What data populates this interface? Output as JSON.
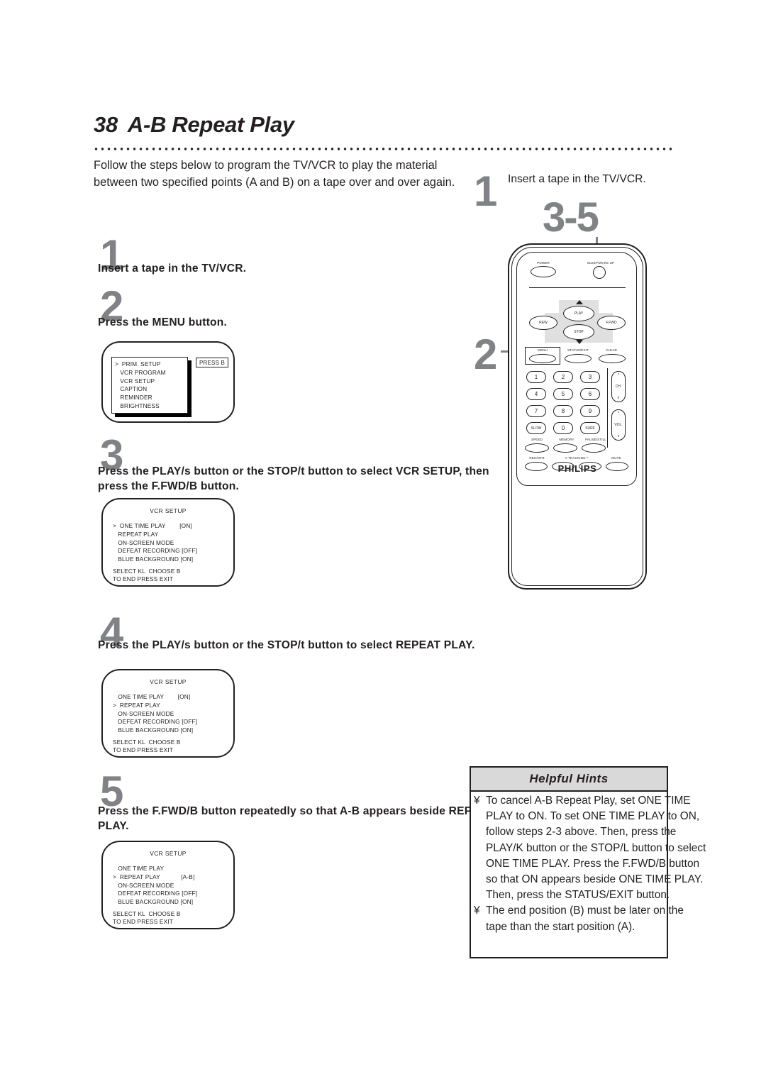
{
  "header": {
    "page_number": "38",
    "title": "A-B Repeat Play"
  },
  "intro": "Follow the steps below to program the TV/VCR to play the material between two specified points (A and B) on a tape over and over again.",
  "left_steps": [
    {
      "number": "1",
      "text": "Insert a tape in the TV/VCR."
    },
    {
      "number": "2",
      "text": "Press the MENU button."
    },
    {
      "number": "3",
      "text": "Press the PLAY/s button or the STOP/t button to select VCR SETUP, then press the F.FWD/B button."
    },
    {
      "number": "4",
      "text": "Press the PLAY/s button or the STOP/t button to select REPEAT PLAY."
    },
    {
      "number": "5",
      "text": "Press the F.FWD/B button repeatedly so that A-B appears beside REPEAT PLAY."
    }
  ],
  "menu_screen": {
    "items": ">  PRIM. SETUP\n   VCR PROGRAM\n   VCR SETUP\n   CAPTION\n   REMINDER\n   BRIGHTNESS",
    "press_label": "PRESS B"
  },
  "osd_screens": [
    {
      "heading": "VCR SETUP",
      "list": ">  ONE TIME PLAY        [ON]\n   REPEAT PLAY\n   ON-SCREEN MODE\n   DEFEAT RECORDING [OFF]\n   BLUE BACKGROUND [ON]",
      "footer": "SELECT KL  CHOOSE B\nTO END PRESS EXIT"
    },
    {
      "heading": "VCR SETUP",
      "list": "   ONE TIME PLAY        [ON]\n>  REPEAT PLAY\n   ON-SCREEN MODE\n   DEFEAT RECORDING [OFF]\n   BLUE BACKGROUND [ON]",
      "footer": "SELECT KL  CHOOSE B\nTO END PRESS EXIT"
    },
    {
      "heading": "VCR SETUP",
      "list": "   ONE TIME PLAY\n>  REPEAT PLAY            [A-B]\n   ON-SCREEN MODE\n   DEFEAT RECORDING [OFF]\n   BLUE BACKGROUND [ON]",
      "footer": "SELECT KL  CHOOSE B\nTO END PRESS EXIT"
    }
  ],
  "right_column": {
    "step1_number": "1",
    "step1_text": "Insert a tape in the TV/VCR.",
    "steps_callout": "3-5",
    "step2_number": "2"
  },
  "remote": {
    "power_label": "POWER",
    "sleep_label": "SLEEP/WAKE UP",
    "play_label": "PLAY",
    "rew_label": "REW",
    "ffwd_label": "F.FWD",
    "stop_label": "STOP",
    "menu_label": "MENU",
    "status_label": "STATUS/EXIT",
    "clear_label": "CLEAR",
    "keys": [
      "1",
      "2",
      "3",
      "4",
      "5",
      "6",
      "7",
      "8",
      "9"
    ],
    "slow_label": "SLOW",
    "zero_label": "0",
    "surf_label": "SURF",
    "ch_label": "CH.",
    "vol_label": "VOL.",
    "speed_label": "SPEED",
    "memory_label": "MEMORY",
    "pause_label": "PAUSE/STILL",
    "rec_label": "REC/OTR",
    "tracking_label": "TRACKING",
    "tracking_down": "V",
    "tracking_up": "^",
    "mute_label": "MUTE",
    "brand": "PHILIPS"
  },
  "hints": {
    "title": "Helpful Hints",
    "bullet": "¥",
    "items": [
      "To cancel A-B Repeat Play, set ONE TIME PLAY to ON. To set ONE TIME PLAY to ON, follow steps 2-3 above. Then, press the PLAY/K button or the STOP/L button to select ONE TIME PLAY. Press the F.FWD/B button so that ON appears beside ONE TIME PLAY. Then, press the STATUS/EXIT button.",
      "The end position (B) must be later on the tape than the start position (A)."
    ]
  },
  "colors": {
    "ink": "#231f20",
    "gray_numbers": "#808285",
    "hints_header_bg": "#d9d9d9",
    "dpad_bg": "#e0e0e0"
  }
}
